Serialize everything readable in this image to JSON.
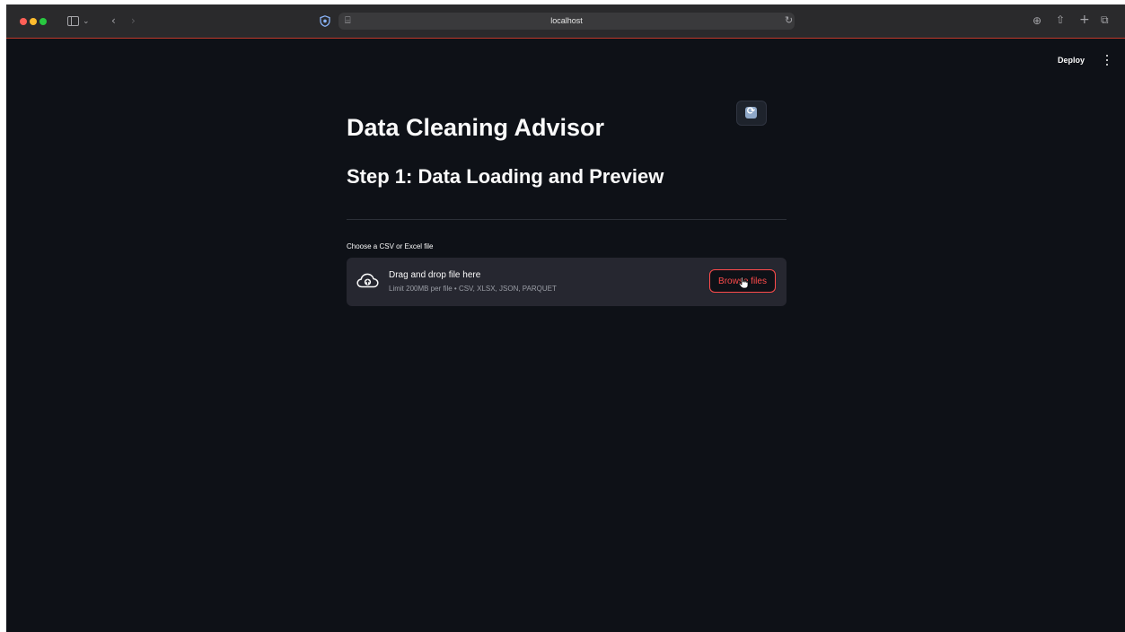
{
  "browser": {
    "url": "localhost"
  },
  "header": {
    "deploy_label": "Deploy"
  },
  "main": {
    "title": "Data Cleaning Advisor",
    "subtitle": "Step 1: Data Loading and Preview",
    "uploader": {
      "label": "Choose a CSV or Excel file",
      "drop_title": "Drag and drop file here",
      "drop_hint": "Limit 200MB per file • CSV, XLSX, JSON, PARQUET",
      "browse_label": "Browse files"
    }
  },
  "colors": {
    "background": "#0e1117",
    "accent": "#ff4b4b",
    "dropzone": "#262730"
  }
}
